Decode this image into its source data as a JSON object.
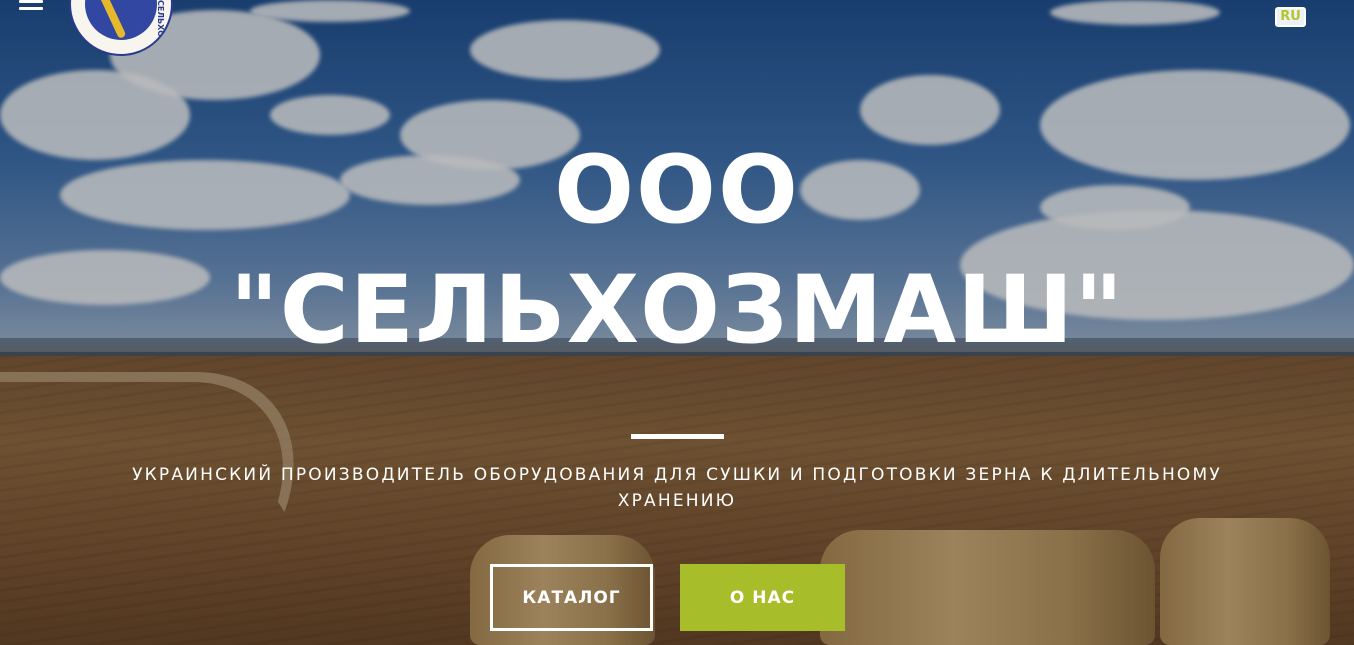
{
  "header": {
    "logo_text": "СЕЛЬХОЗМАШ",
    "language": "RU"
  },
  "hero": {
    "title_line1": "ООО",
    "title_line2": "\"СЕЛЬХОЗМАШ\"",
    "subtitle": "УКРАИНСКИЙ ПРОИЗВОДИТЕЛЬ ОБОРУДОВАНИЯ ДЛЯ СУШКИ И ПОДГОТОВКИ ЗЕРНА К ДЛИТЕЛЬНОМУ ХРАНЕНИЮ",
    "buttons": {
      "catalog": "КАТАЛОГ",
      "about": "О НАС"
    }
  },
  "colors": {
    "accent": "#a8bd2a",
    "text": "#ffffff",
    "logo_blue": "#2a3b8f",
    "logo_gold": "#e6b82c"
  },
  "icons": [
    "hamburger-menu-icon"
  ]
}
